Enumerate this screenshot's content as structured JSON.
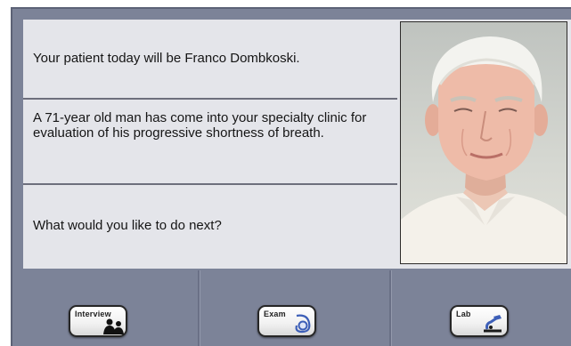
{
  "case": {
    "intro": "Your patient today will be Franco Dombkoski.",
    "description": "A 71-year old man has come into your specialty clinic for evaluation of his progressive shortness of breath.",
    "prompt": "What would you like to do next?"
  },
  "actions": {
    "interview_label": "Interview",
    "exam_label": "Exam",
    "lab_label": "Lab"
  },
  "colors": {
    "frame": "#7c8398",
    "panel": "#e4e5ea",
    "icon_blue": "#3d5fb8"
  },
  "icons": {
    "interview": "two-people-icon",
    "exam": "stethoscope-icon",
    "lab": "microscope-icon"
  }
}
